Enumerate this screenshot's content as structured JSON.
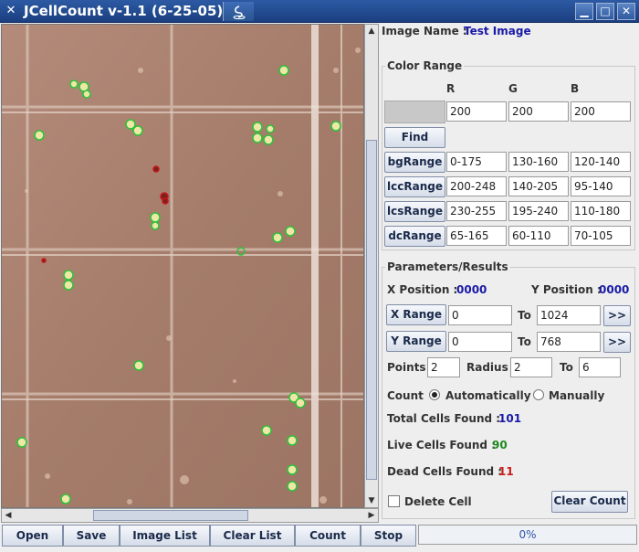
{
  "window": {
    "title": "JCellCount v-1.1 (6-25-05)",
    "controls": [
      "minimize-icon",
      "maximize-icon",
      "close-icon"
    ]
  },
  "image_info": {
    "label": "Image Name :",
    "value": "Test Image"
  },
  "color_range": {
    "title": "Color Range",
    "headers": [
      "R",
      "G",
      "B"
    ],
    "pick": [
      "200",
      "200",
      "200"
    ],
    "find_label": "Find",
    "rows": [
      {
        "label": "bgRange",
        "r": "0-175",
        "g": "130-160",
        "b": "120-140"
      },
      {
        "label": "lccRange",
        "r": "200-248",
        "g": "140-205",
        "b": "95-140"
      },
      {
        "label": "lcsRange",
        "r": "230-255",
        "g": "195-240",
        "b": "110-180"
      },
      {
        "label": "dcRange",
        "r": "65-165",
        "g": "60-110",
        "b": "70-105"
      }
    ]
  },
  "params": {
    "title": "Parameters/Results",
    "x_pos_label": "X Position :",
    "x_pos_value": "0000",
    "y_pos_label": "Y Position :",
    "y_pos_value": "0000",
    "x_range_label": "X Range",
    "x_from": "0",
    "x_to_label": "To",
    "x_to": "1024",
    "x_go": ">>",
    "y_range_label": "Y Range",
    "y_from": "0",
    "y_to_label": "To",
    "y_to": "768",
    "y_go": ">>",
    "points_label": "Points",
    "points": "2",
    "radius_label": "Radius",
    "radius": "2",
    "radius_to_label": "To",
    "radius_to": "6",
    "count_label": "Count",
    "auto_label": "Automatically",
    "manual_label": "Manually",
    "total_label": "Total Cells Found :",
    "total": "101",
    "live_label": "Live Cells Found :",
    "live": "90",
    "dead_label": "Dead Cells Found :",
    "dead": "11",
    "delete_label": "Delete Cell",
    "clear_count_label": "Clear Count"
  },
  "bottom": {
    "buttons": [
      "Open",
      "Save",
      "Image List",
      "Clear List",
      "Count",
      "Stop"
    ],
    "progress_text": "0%",
    "progress_fraction": 0
  },
  "colors": {
    "live_marker": "#2ec23a",
    "dead_marker": "#c41a1a",
    "background": "#a9806f"
  }
}
